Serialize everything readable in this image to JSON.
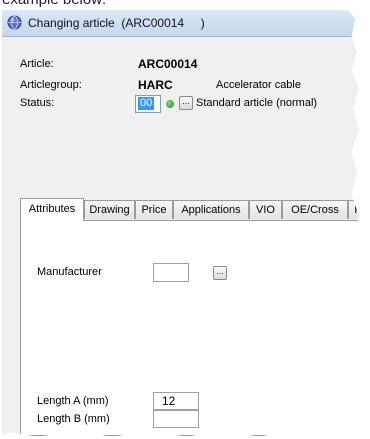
{
  "caption": "example below:",
  "window": {
    "title": "Changing article  (ARC00014     )"
  },
  "header": {
    "article_label": "Article:",
    "article_value": "ARC00014",
    "articlegroup_label": "Articlegroup:",
    "articlegroup_value": "HARC",
    "articlegroup_desc": "Accelerator cable",
    "status_label": "Status:",
    "status_value": "00",
    "status_desc": "Standard article (normal)"
  },
  "tabs": [
    {
      "label": "Attributes",
      "active": true
    },
    {
      "label": "Drawing"
    },
    {
      "label": "Price"
    },
    {
      "label": "Applications"
    },
    {
      "label": "VIO"
    },
    {
      "label": "OE/Cross"
    },
    {
      "label": "P"
    }
  ],
  "attributes": {
    "manufacturer_label": "Manufacturer",
    "manufacturer_value": "",
    "length_a_label": "Length A (mm)",
    "length_a_value": "12",
    "length_b_label": "Length B (mm)",
    "length_b_value": ""
  },
  "colors": {
    "titlebar": "#c4d7ef",
    "selection": "#3399ff",
    "status_ok": "#1c8a1c"
  }
}
